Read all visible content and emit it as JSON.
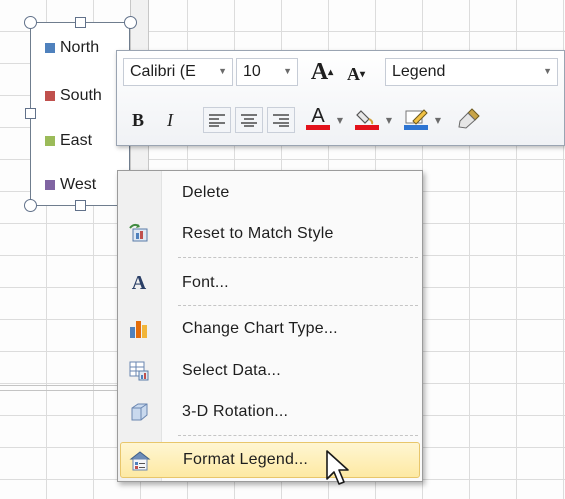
{
  "legend": {
    "entries": [
      {
        "label": "North",
        "color": "#4f81bd"
      },
      {
        "label": "South",
        "color": "#c0504d"
      },
      {
        "label": "East",
        "color": "#9bbb59"
      },
      {
        "label": "West",
        "color": "#8064a2"
      }
    ]
  },
  "mini_toolbar": {
    "font_name": "Calibri (E",
    "font_size": "10",
    "grow_font_glyph": "A",
    "shrink_font_glyph": "A",
    "element_selector": "Legend",
    "bold_glyph": "B",
    "italic_glyph": "I",
    "font_color_glyph": "A",
    "font_color": "#e3121b",
    "fill_color": "#e3121b",
    "line_color": "#2e75d2"
  },
  "context_menu": {
    "items": [
      {
        "label": "Delete",
        "icon": "none"
      },
      {
        "label": "Reset to Match Style",
        "icon": "reset-style-icon"
      },
      {
        "label": "Font...",
        "icon": "font-icon",
        "glyph": "A"
      },
      {
        "label": "Change Chart Type...",
        "icon": "chart-type-icon"
      },
      {
        "label": "Select Data...",
        "icon": "select-data-icon"
      },
      {
        "label": "3-D Rotation...",
        "icon": "rotation-3d-icon"
      },
      {
        "label": "Format Legend...",
        "icon": "format-legend-icon"
      }
    ],
    "highlighted_index": 6
  }
}
